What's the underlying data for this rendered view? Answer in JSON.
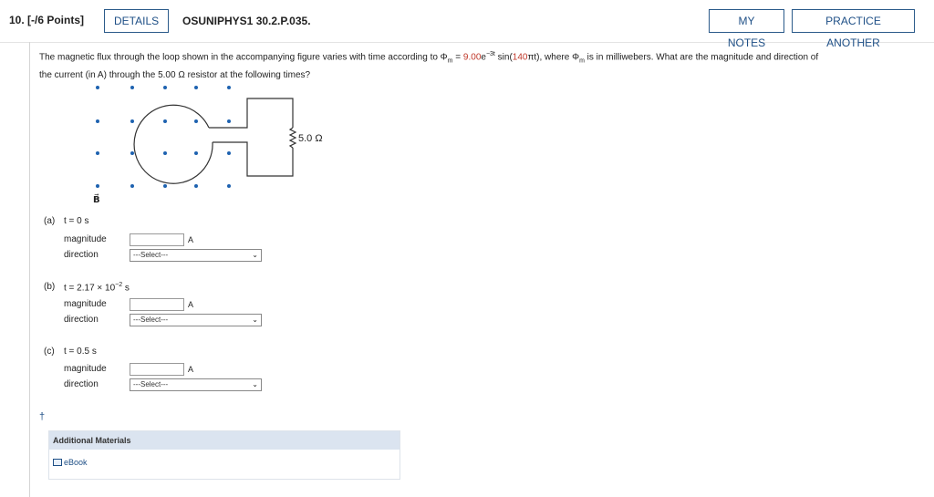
{
  "header": {
    "question_label": "10.  [-/6 Points]",
    "details_label": "DETAILS",
    "question_id": "OSUNIPHYS1 30.2.P.035.",
    "my_notes_label": "MY NOTES",
    "practice_label": "PRACTICE ANOTHER"
  },
  "problem": {
    "p1": "The magnetic flux through the loop shown in the accompanying figure varies with time according to Φ",
    "sub_m": "m",
    "eq": " = ",
    "coef": "9.00",
    "e": "e",
    "exp": "−3t",
    "sin_open": " sin(",
    "omega": "140",
    "pi_t": "πt",
    "sin_close": "), where Φ",
    "sub_m2": "m",
    "p2": " is in milliwebers. What are the magnitude and direction of",
    "line2": "the current (in A) through the 5.00 Ω resistor at the following times?"
  },
  "figure": {
    "resistor_label": "5.0 Ω",
    "field_label": "B⃗"
  },
  "parts": [
    {
      "label": "(a)",
      "time": "t = 0 s",
      "magnitude_label": "magnitude",
      "unit": "A",
      "direction_label": "direction",
      "select": "---Select---"
    },
    {
      "label": "(b)",
      "time_prefix": "t = 2.17 × 10",
      "time_exp": "−2",
      "time_suffix": " s",
      "magnitude_label": "magnitude",
      "unit": "A",
      "direction_label": "direction",
      "select": "---Select---"
    },
    {
      "label": "(c)",
      "time": "t = 0.5 s",
      "magnitude_label": "magnitude",
      "unit": "A",
      "direction_label": "direction",
      "select": "---Select---"
    }
  ],
  "additional": {
    "dagger": "†",
    "title": "Additional Materials",
    "ebook": "eBook"
  }
}
